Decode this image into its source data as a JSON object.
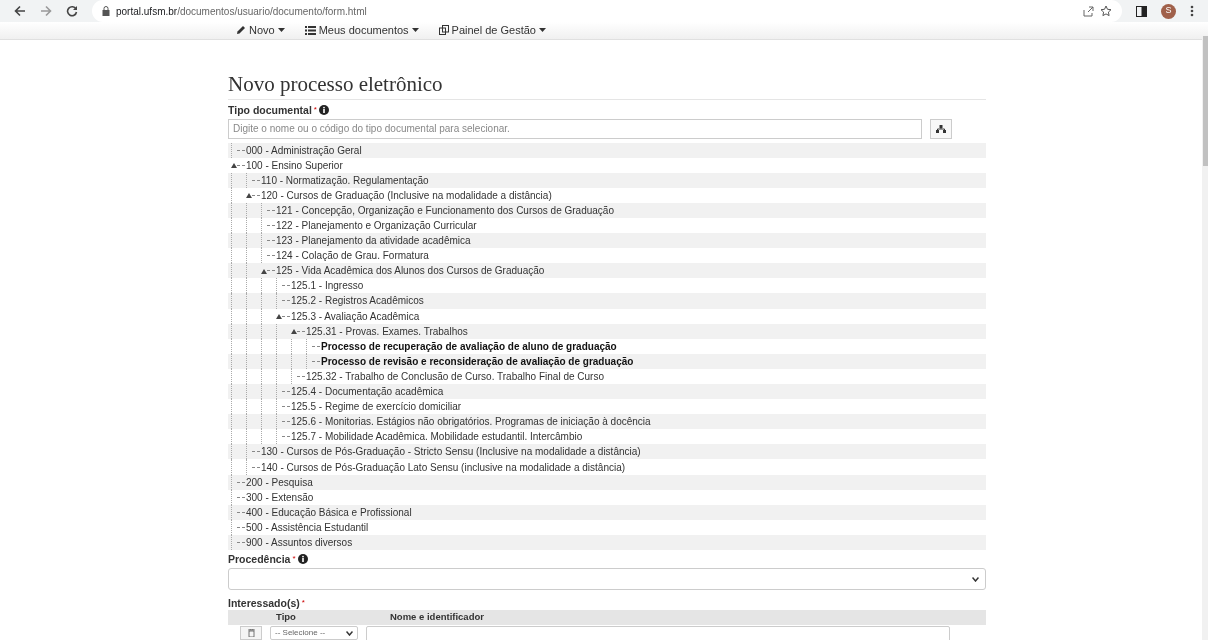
{
  "browser": {
    "url_domain": "portal.ufsm.br",
    "url_path": "/documentos/usuario/documento/form.html",
    "profile_initial": "S"
  },
  "nav": [
    {
      "label": "Novo"
    },
    {
      "label": "Meus documentos"
    },
    {
      "label": "Painel de Gestão"
    }
  ],
  "title": "Novo processo eletrônico",
  "tipo_documental": {
    "label": "Tipo documental",
    "required_mark": "*",
    "placeholder": "Digite o nome ou o código do tipo documental para selecionar."
  },
  "tree": [
    {
      "label": "000 - Administração Geral",
      "kind": "category"
    },
    {
      "label": "100 - Ensino Superior",
      "kind": "category",
      "expanded": true,
      "children": [
        {
          "label": "110 - Normatização. Regulamentação",
          "kind": "category"
        },
        {
          "label": "120 - Cursos de Graduação (Inclusive na modalidade a distância)",
          "kind": "category",
          "expanded": true,
          "children": [
            {
              "label": "121 - Concepção, Organização e Funcionamento dos Cursos de Graduação",
              "kind": "category"
            },
            {
              "label": "122 - Planejamento e Organização Curricular",
              "kind": "category"
            },
            {
              "label": "123 - Planejamento da atividade acadêmica",
              "kind": "category"
            },
            {
              "label": "124 - Colação de Grau. Formatura",
              "kind": "category"
            },
            {
              "label": "125 - Vida Acadêmica dos Alunos dos Cursos de Graduação",
              "kind": "category",
              "expanded": true,
              "children": [
                {
                  "label": "125.1 - Ingresso",
                  "kind": "category"
                },
                {
                  "label": "125.2 - Registros Acadêmicos",
                  "kind": "category"
                },
                {
                  "label": "125.3 - Avaliação Acadêmica",
                  "kind": "category",
                  "expanded": true,
                  "children": [
                    {
                      "label": "125.31 - Provas. Exames. Trabalhos",
                      "kind": "category",
                      "expanded": true,
                      "children": [
                        {
                          "label": "Processo de recuperação de avaliação de aluno de graduação",
                          "kind": "process"
                        },
                        {
                          "label": "Processo de revisão e reconsideração de avaliação de graduação",
                          "kind": "process"
                        }
                      ]
                    },
                    {
                      "label": "125.32 - Trabalho de Conclusão de Curso. Trabalho Final de Curso",
                      "kind": "category"
                    }
                  ]
                },
                {
                  "label": "125.4 - Documentação acadêmica",
                  "kind": "category"
                },
                {
                  "label": "125.5 - Regime de exercício domiciliar",
                  "kind": "category"
                },
                {
                  "label": "125.6 - Monitorias. Estágios não obrigatórios. Programas de iniciação à docência",
                  "kind": "category"
                },
                {
                  "label": "125.7 - Mobilidade Acadêmica. Mobilidade estudantil. Intercâmbio",
                  "kind": "category"
                }
              ]
            }
          ]
        },
        {
          "label": "130 - Cursos de Pós-Graduação - Stricto Sensu (Inclusive na modalidade a distância)",
          "kind": "category"
        },
        {
          "label": "140 - Cursos de Pós-Graduação Lato Sensu (inclusive na modalidade a distância)",
          "kind": "category"
        }
      ]
    },
    {
      "label": "200 - Pesquisa",
      "kind": "category"
    },
    {
      "label": "300 - Extensão",
      "kind": "category"
    },
    {
      "label": "400 - Educação Básica e Profissional",
      "kind": "category"
    },
    {
      "label": "500 - Assistência Estudantil",
      "kind": "category"
    },
    {
      "label": "900 - Assuntos diversos",
      "kind": "category"
    }
  ],
  "procedencia": {
    "label": "Procedência",
    "required_mark": "*"
  },
  "interessados": {
    "label": "Interessado(s)",
    "required_mark": "*",
    "columns": [
      "Tipo",
      "Nome e identificador"
    ],
    "tipo_value": "-- Selecione --"
  }
}
